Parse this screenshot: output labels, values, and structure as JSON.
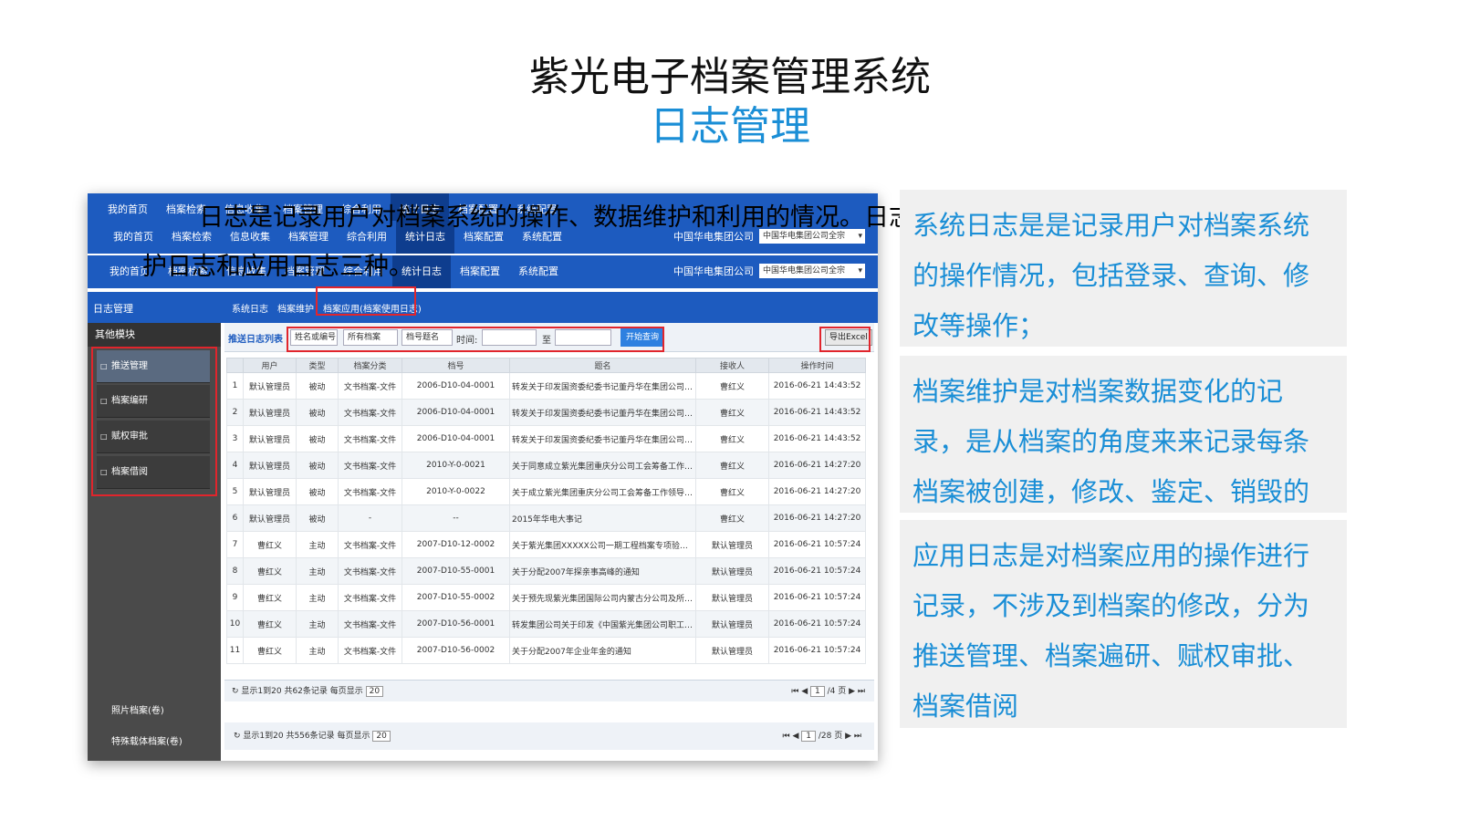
{
  "slide": {
    "title": "紫光电子档案管理系统",
    "subtitle": "日志管理",
    "overlay_line1": "日志是记录用户对档案系统的操作、数据维护和利用的情况。日志分为系统日志、档案维",
    "overlay_line2": "护日志和应用日志三种。"
  },
  "app": {
    "nav_items": [
      "我的首页",
      "档案检索",
      "信息收集",
      "档案管理",
      "综合利用",
      "统计日志",
      "档案配置",
      "系统配置"
    ],
    "nav2_items": [
      "我的首页",
      "档案检索",
      "信息收集",
      "档案管理",
      "综合利用",
      "统计日志",
      "档案配置",
      "系统配置"
    ],
    "company_label": "中国华电集团公司",
    "company_select": "中国华电集团公司全宗",
    "section_title": "日志管理",
    "tabs": [
      "系统日志",
      "档案维护",
      "档案应用(档案使用日志)"
    ],
    "sidebar_header": "其他模块",
    "sidebar_items": [
      "推送管理",
      "档案编研",
      "赋权审批",
      "档案借阅"
    ],
    "sidebar_extra": [
      "照片档案(卷)",
      "特殊载体档案(卷)"
    ],
    "toolbar": {
      "label": "推送日志列表",
      "search_placeholder": "姓名或编号",
      "archive_select": "所有档案",
      "title_field": "档号题名",
      "time_label": "时间:",
      "to_label": "至",
      "query_button": "开始查询",
      "export_button": "导出Excel"
    },
    "columns": [
      "",
      "用户",
      "类型",
      "档案分类",
      "档号",
      "题名",
      "接收人",
      "操作时间"
    ],
    "rows": [
      [
        "1",
        "默认管理员",
        "被动",
        "文书档案-文件",
        "2006-D10-04-0001",
        "转发关于印发国资委纪委书记董丹华在集团公司调研时...",
        "曹红义",
        "2016-06-21 14:43:52"
      ],
      [
        "2",
        "默认管理员",
        "被动",
        "文书档案-文件",
        "2006-D10-04-0001",
        "转发关于印发国资委纪委书记董丹华在集团公司调研时...",
        "曹红义",
        "2016-06-21 14:43:52"
      ],
      [
        "3",
        "默认管理员",
        "被动",
        "文书档案-文件",
        "2006-D10-04-0001",
        "转发关于印发国资委纪委书记董丹华在集团公司调研时...",
        "曹红义",
        "2016-06-21 14:43:52"
      ],
      [
        "4",
        "默认管理员",
        "被动",
        "文书档案-文件",
        "2010-Y-0-0021",
        "关于同意成立紫光集团重庆分公司工会筹备工作领导小...",
        "曹红义",
        "2016-06-21 14:27:20"
      ],
      [
        "5",
        "默认管理员",
        "被动",
        "文书档案-文件",
        "2010-Y-0-0022",
        "关于成立紫光集团重庆分公司工会筹备工作领导小组的...",
        "曹红义",
        "2016-06-21 14:27:20"
      ],
      [
        "6",
        "默认管理员",
        "被动",
        "-",
        "--",
        "2015年华电大事记",
        "曹红义",
        "2016-06-21 14:27:20"
      ],
      [
        "7",
        "曹红义",
        "主动",
        "文书档案-文件",
        "2007-D10-12-0002",
        "关于紫光集团XXXXX公司一期工程档案专项验收的请示",
        "默认管理员",
        "2016-06-21 10:57:24"
      ],
      [
        "8",
        "曹红义",
        "主动",
        "文书档案-文件",
        "2007-D10-55-0001",
        "关于分配2007年探亲事高峰的通知",
        "默认管理员",
        "2016-06-21 10:57:24"
      ],
      [
        "9",
        "曹红义",
        "主动",
        "文书档案-文件",
        "2007-D10-55-0002",
        "关于预先现紫光集团国际公司内蒙古分公司及所辖项目...",
        "默认管理员",
        "2016-06-21 10:57:24"
      ],
      [
        "10",
        "曹红义",
        "主动",
        "文书档案-文件",
        "2007-D10-56-0001",
        "转发集团公司关于印发《中国紫光集团公司职工教...",
        "默认管理员",
        "2016-06-21 10:57:24"
      ],
      [
        "11",
        "曹红义",
        "主动",
        "文书档案-文件",
        "2007-D10-56-0002",
        "关于分配2007年企业年金的通知",
        "默认管理员",
        "2016-06-21 10:57:24"
      ]
    ],
    "pager": {
      "info": "显示1到20 共62条记录 每页显示",
      "page_size": "20",
      "page": "1",
      "total_pages": "/4 页"
    },
    "pager2": {
      "info": "显示1到20 共556条记录 每页显示",
      "page_size": "20",
      "page": "1",
      "total_pages": "/28 页"
    }
  },
  "panel": {
    "block1": "系统日志是是记录用户对档案系统的操作情况，包括登录、查询、修改等操作；",
    "block2": "档案维护是对档案数据变化的记录，是从档案的角度来来记录每条档案被创建，修改、鉴定、销毁的过程。",
    "block3": "应用日志是对档案应用的操作进行记录，不涉及到档案的修改，分为推送管理、档案遍研、赋权审批、档案借阅"
  },
  "colors": {
    "accent": "#1a8ed6",
    "nav": "#1d5bbf",
    "highlight": "#e1252c"
  }
}
